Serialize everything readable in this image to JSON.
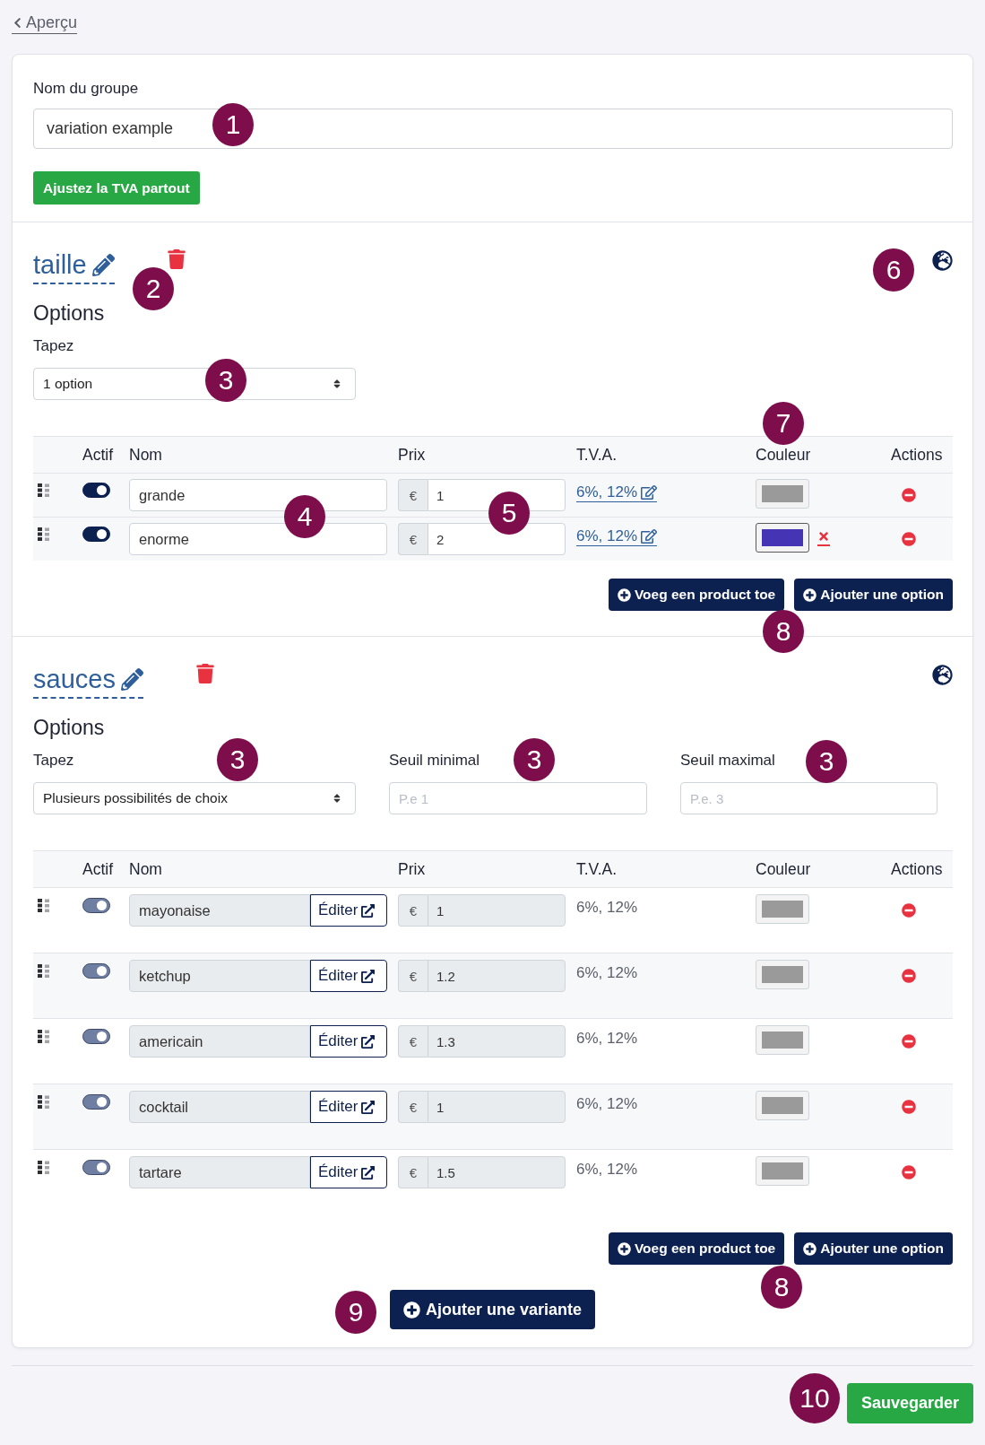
{
  "back_link": {
    "label": "Aperçu"
  },
  "group_name": {
    "label": "Nom du groupe",
    "value": "variation example"
  },
  "vat_button": {
    "label": "Ajustez la TVA partout"
  },
  "variations": [
    {
      "name": "taille",
      "options_title": "Options",
      "fields": [
        {
          "kind": "select",
          "label": "Tapez",
          "value": "1 option"
        }
      ],
      "table": {
        "columns": [
          "Actif",
          "Nom",
          "Prix",
          "T.V.A.",
          "Couleur",
          "Actions"
        ],
        "rows": [
          {
            "kind": "option",
            "active": true,
            "name": "grande",
            "currency": "€",
            "price": "1",
            "vat": "6%, 12%",
            "color": "#9a9a9a",
            "color_set": false
          },
          {
            "kind": "option",
            "active": true,
            "name": "enorme",
            "currency": "€",
            "price": "2",
            "vat": "6%, 12%",
            "color": "#4535b5",
            "color_set": true
          }
        ]
      },
      "buttons": [
        "Voeg een product toe",
        "Ajouter une option"
      ]
    },
    {
      "name": "sauces",
      "options_title": "Options",
      "fields": [
        {
          "kind": "select",
          "label": "Tapez",
          "value": "Plusieurs possibilités de choix"
        },
        {
          "kind": "input",
          "label": "Seuil minimal",
          "placeholder": "P.e 1"
        },
        {
          "kind": "input",
          "label": "Seuil maximal",
          "placeholder": "P.e. 3"
        }
      ],
      "table": {
        "columns": [
          "Actif",
          "Nom",
          "Prix",
          "T.V.A.",
          "Couleur",
          "Actions"
        ],
        "rows": [
          {
            "kind": "product",
            "active": true,
            "name": "mayonaise",
            "edit_label": "Éditer",
            "currency": "€",
            "price": "1",
            "vat": "6%, 12%",
            "color": "#9a9a9a",
            "color_set": false
          },
          {
            "kind": "product",
            "active": true,
            "name": "ketchup",
            "edit_label": "Éditer",
            "currency": "€",
            "price": "1.2",
            "vat": "6%, 12%",
            "color": "#9a9a9a",
            "color_set": false
          },
          {
            "kind": "product",
            "active": true,
            "name": "americain",
            "edit_label": "Éditer",
            "currency": "€",
            "price": "1.3",
            "vat": "6%, 12%",
            "color": "#9a9a9a",
            "color_set": false
          },
          {
            "kind": "product",
            "active": true,
            "name": "cocktail",
            "edit_label": "Éditer",
            "currency": "€",
            "price": "1",
            "vat": "6%, 12%",
            "color": "#9a9a9a",
            "color_set": false
          },
          {
            "kind": "product",
            "active": true,
            "name": "tartare",
            "edit_label": "Éditer",
            "currency": "€",
            "price": "1.5",
            "vat": "6%, 12%",
            "color": "#9a9a9a",
            "color_set": false
          }
        ]
      },
      "buttons": [
        "Voeg een product toe",
        "Ajouter une option"
      ]
    }
  ],
  "add_variant_button": {
    "label": "Ajouter une variante"
  },
  "save_button": {
    "label": "Sauvegarder"
  },
  "callouts": [
    {
      "label": "1"
    },
    {
      "label": "2"
    },
    {
      "label": "6"
    },
    {
      "label": "3"
    },
    {
      "label": "7"
    },
    {
      "label": "4"
    },
    {
      "label": "5"
    },
    {
      "label": "8"
    },
    {
      "label": "3"
    },
    {
      "label": "3"
    },
    {
      "label": "3"
    },
    {
      "label": "8"
    },
    {
      "label": "9"
    },
    {
      "label": "10"
    }
  ]
}
